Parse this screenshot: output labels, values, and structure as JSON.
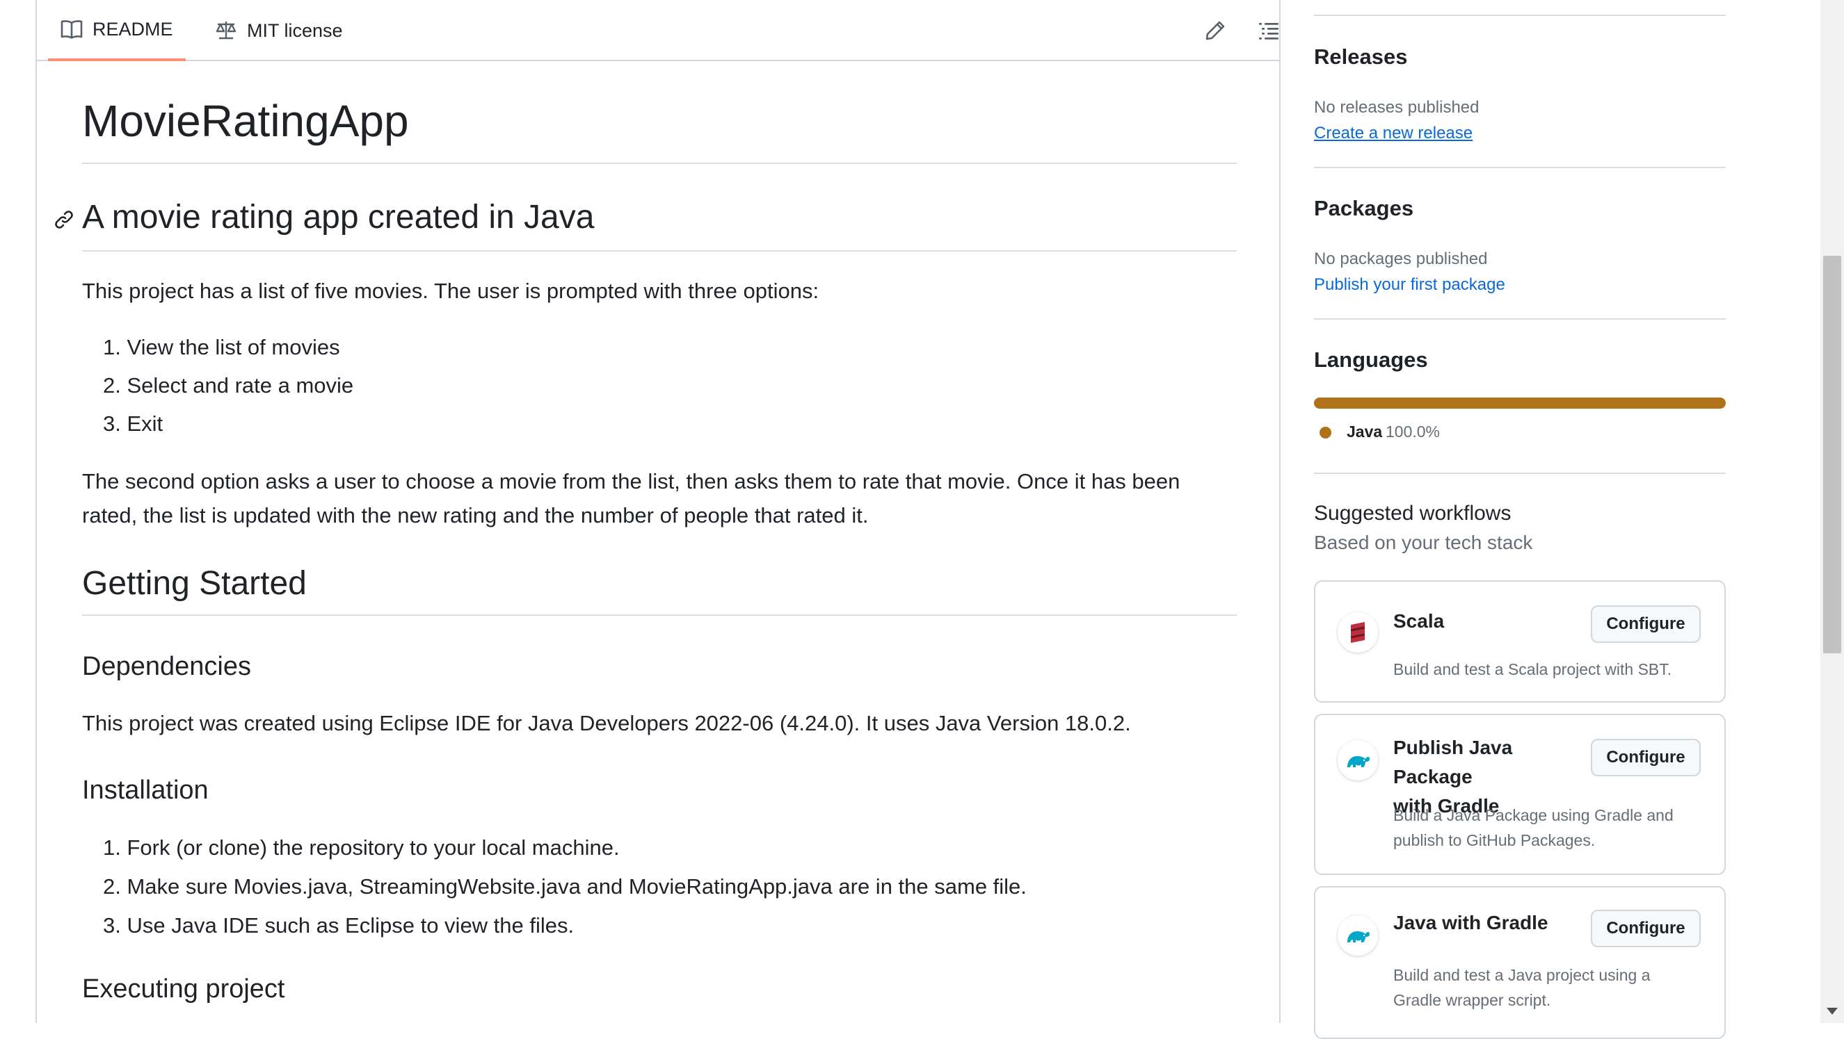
{
  "readme_header": {
    "tab_readme": "README",
    "tab_license": "MIT license"
  },
  "readme": {
    "title": "MovieRatingApp",
    "subtitle": "A movie rating app created in Java",
    "intro": "This project has a list of five movies. The user is prompted with three options:",
    "options": [
      "1. View the list of movies",
      "2. Select and rate a movie",
      "3. Exit"
    ],
    "paragraph2_line1": "The second option asks a user to choose a movie from the list, then asks them to rate that movie. Once it has been",
    "paragraph2_line2": "rated, the list is updated with the new rating and the number of people that rated it.",
    "getting_started": "Getting Started",
    "dependencies_heading": "Dependencies",
    "dependencies_text": "This project was created using Eclipse IDE for Java Developers 2022-06 (4.24.0). It uses Java Version 18.0.2.",
    "installation_heading": "Installation",
    "installation_steps": [
      "1. Fork (or clone) the repository to your local machine.",
      "2. Make sure Movies.java, StreamingWebsite.java and MovieRatingApp.java are in the same file.",
      "3. Use Java IDE such as Eclipse to view the files."
    ],
    "executing_heading": "Executing project"
  },
  "sidebar": {
    "releases": {
      "title": "Releases",
      "status": "No releases published",
      "link": "Create a new release"
    },
    "packages": {
      "title": "Packages",
      "status": "No packages published",
      "link": "Publish your first package"
    },
    "languages": {
      "title": "Languages",
      "items": [
        {
          "name": "Java",
          "percent": "100.0%",
          "color": "#b07219"
        }
      ]
    },
    "workflows": {
      "title": "Suggested workflows",
      "subtitle": "Based on your tech stack",
      "items": [
        {
          "name": "Scala",
          "description": "Build and test a Scala project with SBT.",
          "button": "Configure",
          "icon": "scala-logo-icon"
        },
        {
          "name_line1": "Publish Java Package",
          "name_line2": "with Gradle",
          "description_line1": "Build a Java Package using Gradle and",
          "description_line2": "publish to GitHub Packages.",
          "button": "Configure",
          "icon": "gradle-elephant-icon"
        },
        {
          "name": "Java with Gradle",
          "description_line1": "Build and test a Java project using a",
          "description_line2": "Gradle wrapper script.",
          "button": "Configure",
          "icon": "gradle-elephant-icon"
        }
      ]
    }
  },
  "colors": {
    "accent_tab_underline": "#fd8c73",
    "link": "#0969da",
    "java": "#b07219",
    "scala": "#c22d40",
    "gradle": "#02a6c8"
  }
}
